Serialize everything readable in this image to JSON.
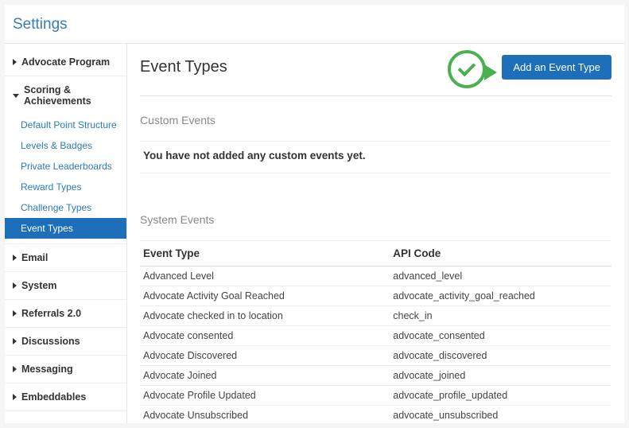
{
  "header": {
    "title": "Settings"
  },
  "sidebar": {
    "sections": [
      {
        "label": "Advocate Program",
        "expanded": false,
        "items": []
      },
      {
        "label": "Scoring & Achievements",
        "expanded": true,
        "items": [
          {
            "label": "Default Point Structure",
            "active": false
          },
          {
            "label": "Levels & Badges",
            "active": false
          },
          {
            "label": "Private Leaderboards",
            "active": false
          },
          {
            "label": "Reward Types",
            "active": false
          },
          {
            "label": "Challenge Types",
            "active": false
          },
          {
            "label": "Event Types",
            "active": true
          }
        ]
      },
      {
        "label": "Email",
        "expanded": false,
        "items": []
      },
      {
        "label": "System",
        "expanded": false,
        "items": []
      },
      {
        "label": "Referrals 2.0",
        "expanded": false,
        "items": []
      },
      {
        "label": "Discussions",
        "expanded": false,
        "items": []
      },
      {
        "label": "Messaging",
        "expanded": false,
        "items": []
      },
      {
        "label": "Embeddables",
        "expanded": false,
        "items": []
      }
    ]
  },
  "main": {
    "title": "Event Types",
    "add_button": "Add an Event Type",
    "custom_section_title": "Custom Events",
    "custom_empty": "You have not added any custom events yet.",
    "system_section_title": "System Events",
    "table_headers": {
      "col1": "Event Type",
      "col2": "API Code"
    },
    "system_events": [
      {
        "name": "Advanced Level",
        "code": "advanced_level"
      },
      {
        "name": "Advocate Activity Goal Reached",
        "code": "advocate_activity_goal_reached"
      },
      {
        "name": "Advocate checked in to location",
        "code": "check_in"
      },
      {
        "name": "Advocate consented",
        "code": "advocate_consented"
      },
      {
        "name": "Advocate Discovered",
        "code": "advocate_discovered"
      },
      {
        "name": "Advocate Joined",
        "code": "advocate_joined"
      },
      {
        "name": "Advocate Profile Updated",
        "code": "advocate_profile_updated"
      },
      {
        "name": "Advocate Unsubscribed",
        "code": "advocate_unsubscribed"
      }
    ]
  }
}
